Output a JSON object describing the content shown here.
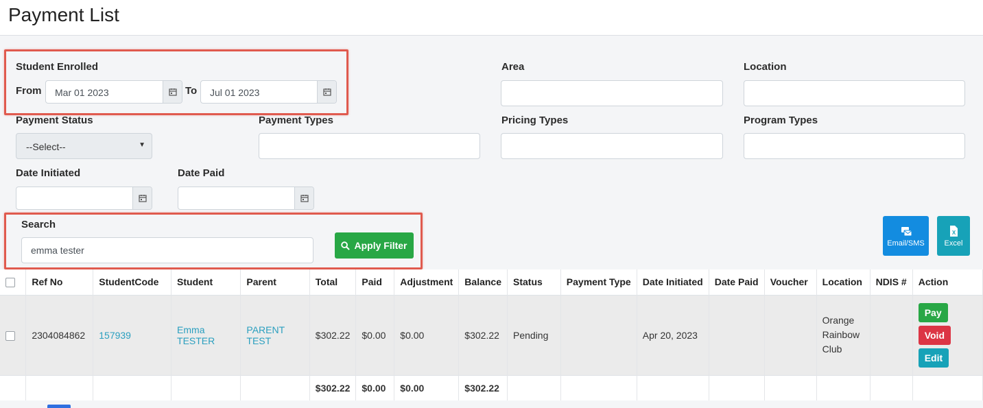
{
  "page": {
    "title": "Payment List"
  },
  "filters": {
    "student_enrolled_label": "Student Enrolled",
    "from_label": "From",
    "from_value": "Mar 01 2023",
    "to_label": "To",
    "to_value": "Jul 01 2023",
    "area_label": "Area",
    "location_label": "Location",
    "payment_status_label": "Payment Status",
    "payment_status_value": "--Select--",
    "payment_types_label": "Payment Types",
    "pricing_types_label": "Pricing Types",
    "program_types_label": "Program Types",
    "date_initiated_label": "Date Initiated",
    "date_paid_label": "Date Paid",
    "search_label": "Search",
    "search_value": "emma tester",
    "apply_label": "Apply Filter"
  },
  "exports": {
    "email_label": "Email/SMS",
    "excel_label": "Excel"
  },
  "table": {
    "headers": [
      "Ref No",
      "StudentCode",
      "Student",
      "Parent",
      "Total",
      "Paid",
      "Adjustment",
      "Balance",
      "Status",
      "Payment Type",
      "Date Initiated",
      "Date Paid",
      "Voucher",
      "Location",
      "NDIS #",
      "Action"
    ],
    "rows": [
      {
        "ref_no": "2304084862",
        "student_code": "157939",
        "student": "Emma TESTER",
        "parent": "PARENT TEST",
        "total": "$302.22",
        "paid": "$0.00",
        "adjustment": "$0.00",
        "balance": "$302.22",
        "status": "Pending",
        "payment_type": "",
        "date_initiated": "Apr 20, 2023",
        "date_paid": "",
        "voucher": "",
        "location": "Orange Rainbow Club",
        "ndis": "",
        "actions": {
          "pay": "Pay",
          "void": "Void",
          "edit": "Edit"
        }
      }
    ],
    "totals": {
      "total": "$302.22",
      "paid": "$0.00",
      "adjustment": "$0.00",
      "balance": "$302.22"
    }
  },
  "colors": {
    "green": "#28a745",
    "red": "#dc3545",
    "teal": "#17a2b8",
    "blue": "#138ce0",
    "highlight": "#e05a4e",
    "link": "#2a9fbf"
  },
  "icons": {
    "calendar": "calendar-icon",
    "search": "search-icon",
    "email": "email-sms-icon",
    "excel": "excel-icon"
  }
}
